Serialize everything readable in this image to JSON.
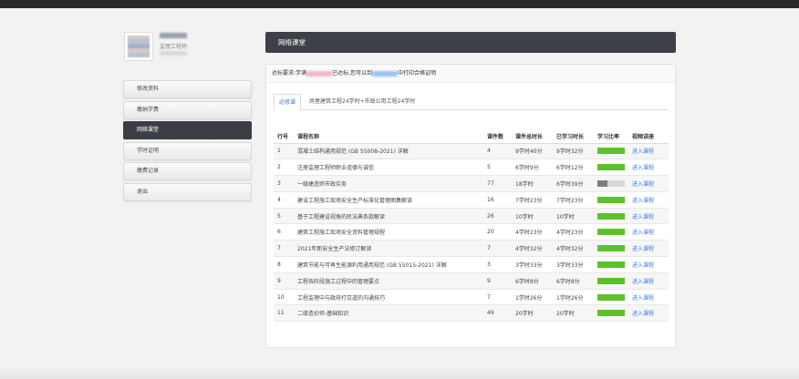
{
  "profile": {
    "role": "监理工程师"
  },
  "sidebar": {
    "items": [
      {
        "label": "修改资料"
      },
      {
        "label": "缴纳学费"
      },
      {
        "label": "网络课堂"
      },
      {
        "label": "学时证明"
      },
      {
        "label": "缴费记录"
      },
      {
        "label": "退出"
      }
    ],
    "active_index": 2
  },
  "header": {
    "title": "网络课堂"
  },
  "notice": {
    "prefix": "达标要求:学满",
    "mid": "已达标,您可以到",
    "suffix": "中打印合格证明"
  },
  "tabs": [
    {
      "label": "必修课"
    },
    {
      "label": "房屋建筑工程24学时+市政公用工程24学时"
    }
  ],
  "colors": {
    "progress_full": "#5ec12a",
    "progress_partial": "#7d7d7d",
    "link": "#3a7bd5",
    "dark": "#3d4047"
  },
  "table": {
    "headers": [
      "行号",
      "课程名称",
      "课件数",
      "课件总时长",
      "已学习时长",
      "学习比率",
      "视频讲座"
    ],
    "rows": [
      {
        "no": "1",
        "name": "混凝土结构通用规范 (GB 55008-2021) 详解",
        "count": "4",
        "total": "9学时40分",
        "learned": "9学时32分",
        "ratio": 1.0,
        "action": "进入课程"
      },
      {
        "no": "2",
        "name": "注册监理工程师职业道德与诚信",
        "count": "5",
        "total": "6学时9分",
        "learned": "6学时12分",
        "ratio": 1.0,
        "action": "进入课程"
      },
      {
        "no": "3",
        "name": "一级建造师市政实务",
        "count": "77",
        "total": "18学时",
        "learned": "6学时39分",
        "ratio": 0.37,
        "action": "进入课程"
      },
      {
        "no": "4",
        "name": "建设工程施工现场安全生产标准化管理图集解读",
        "count": "16",
        "total": "7学时23分",
        "learned": "7学时23分",
        "ratio": 1.0,
        "action": "进入课程"
      },
      {
        "no": "5",
        "name": "基于工程建设视角的民法典条款解读",
        "count": "26",
        "total": "10学时",
        "learned": "10学时",
        "ratio": 1.0,
        "action": "进入课程"
      },
      {
        "no": "6",
        "name": "建筑工程施工现场安全资料管理规程",
        "count": "20",
        "total": "4学时23分",
        "learned": "4学时23分",
        "ratio": 1.0,
        "action": "进入课程"
      },
      {
        "no": "7",
        "name": "2021年新安全生产法修订解读",
        "count": "7",
        "total": "4学时32分",
        "learned": "4学时32分",
        "ratio": 1.0,
        "action": "进入课程"
      },
      {
        "no": "8",
        "name": "建筑节能与可再生能源利用通用规范 (GB 55015-2021) 详解",
        "count": "3",
        "total": "3学时33分",
        "learned": "3学时33分",
        "ratio": 1.0,
        "action": "进入课程"
      },
      {
        "no": "9",
        "name": "工程各阶段施工过程中的管理要点",
        "count": "9",
        "total": "6学时8分",
        "learned": "6学时8分",
        "ratio": 1.0,
        "action": "进入课程"
      },
      {
        "no": "10",
        "name": "工程监理中与政府打交道的沟通技巧",
        "count": "7",
        "total": "1学时26分",
        "learned": "1学时26分",
        "ratio": 1.0,
        "action": "进入课程"
      },
      {
        "no": "11",
        "name": "二级造价师-基础知识",
        "count": "49",
        "total": "20学时",
        "learned": "20学时",
        "ratio": 1.0,
        "action": "进入课程"
      }
    ]
  }
}
